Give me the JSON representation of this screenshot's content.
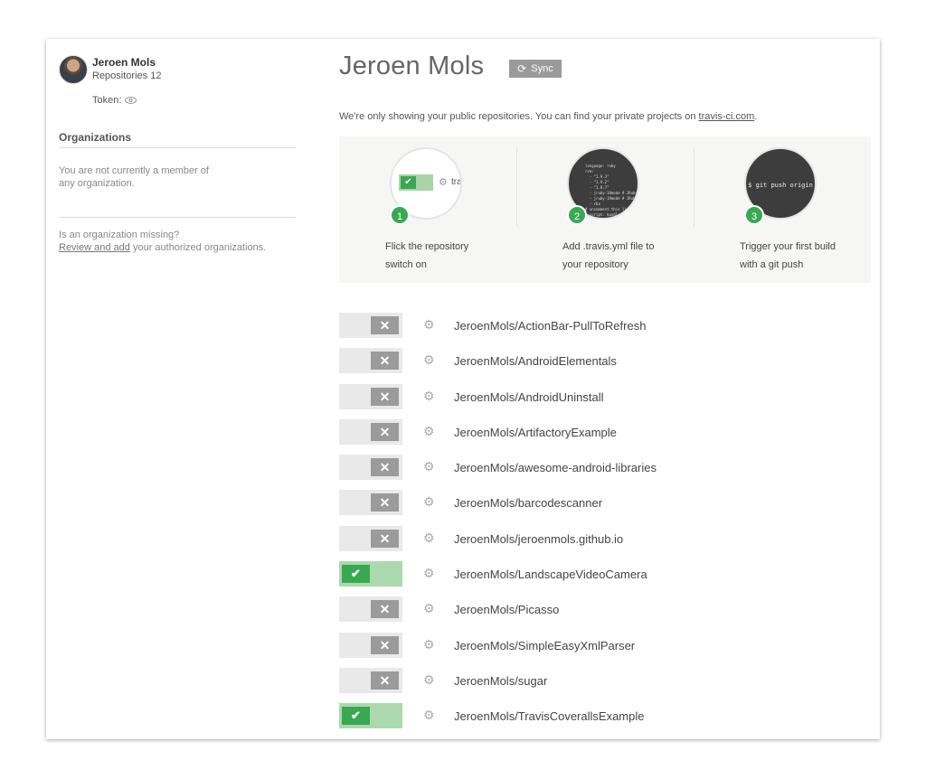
{
  "profile": {
    "name": "Jeroen Mols",
    "repos": "Repositories 12",
    "token": "Token:"
  },
  "sidebar": {
    "org_heading": "Organizations",
    "org_text": "You are not currently a member of any organization.",
    "missing_text": "Is an organization missing?",
    "review_link": "Review and add",
    "review_suffix": " your authorized organizations."
  },
  "main": {
    "title": "Jeroen Mols",
    "sync_label": "Sync",
    "notice_text": "We're only showing your public repositories. You can find your private projects on ",
    "notice_link": "travis-ci.com",
    "notice_end": "."
  },
  "steps": [
    {
      "num": "1",
      "label": "Flick the repository switch on",
      "mini": "tra"
    },
    {
      "num": "2",
      "label": "Add .travis.yml file to your repository",
      "code": "language: ruby\nrvm:\n  - \"1.9.3\"\n  - \"1.9.2\"\n  - \"1.8.7\"\n  - jruby-18mode # JRuby\n  - jruby-19mode # JRuby\n  - rbx\n# uncomment this li\n# script: bundle"
    },
    {
      "num": "3",
      "label": "Trigger your first build with a git push",
      "code": "$ git push origin"
    }
  ],
  "repos": [
    {
      "name": "JeroenMols/ActionBar-PullToRefresh",
      "on": false
    },
    {
      "name": "JeroenMols/AndroidElementals",
      "on": false
    },
    {
      "name": "JeroenMols/AndroidUninstall",
      "on": false
    },
    {
      "name": "JeroenMols/ArtifactoryExample",
      "on": false
    },
    {
      "name": "JeroenMols/awesome-android-libraries",
      "on": false
    },
    {
      "name": "JeroenMols/barcodescanner",
      "on": false
    },
    {
      "name": "JeroenMols/jeroenmols.github.io",
      "on": false
    },
    {
      "name": "JeroenMols/LandscapeVideoCamera",
      "on": true
    },
    {
      "name": "JeroenMols/Picasso",
      "on": false
    },
    {
      "name": "JeroenMols/SimpleEasyXmlParser",
      "on": false
    },
    {
      "name": "JeroenMols/sugar",
      "on": false
    },
    {
      "name": "JeroenMols/TravisCoverallsExample",
      "on": true
    }
  ],
  "colors": {
    "accent": "#39a852",
    "toggle_on_bg": "#acd8ad",
    "toggle_off_knob": "#9b9b9b"
  },
  "icons": {
    "on": "check-icon",
    "off": "close-icon",
    "settings": "gear-icon",
    "token": "eye-icon",
    "sync": "refresh-icon"
  }
}
